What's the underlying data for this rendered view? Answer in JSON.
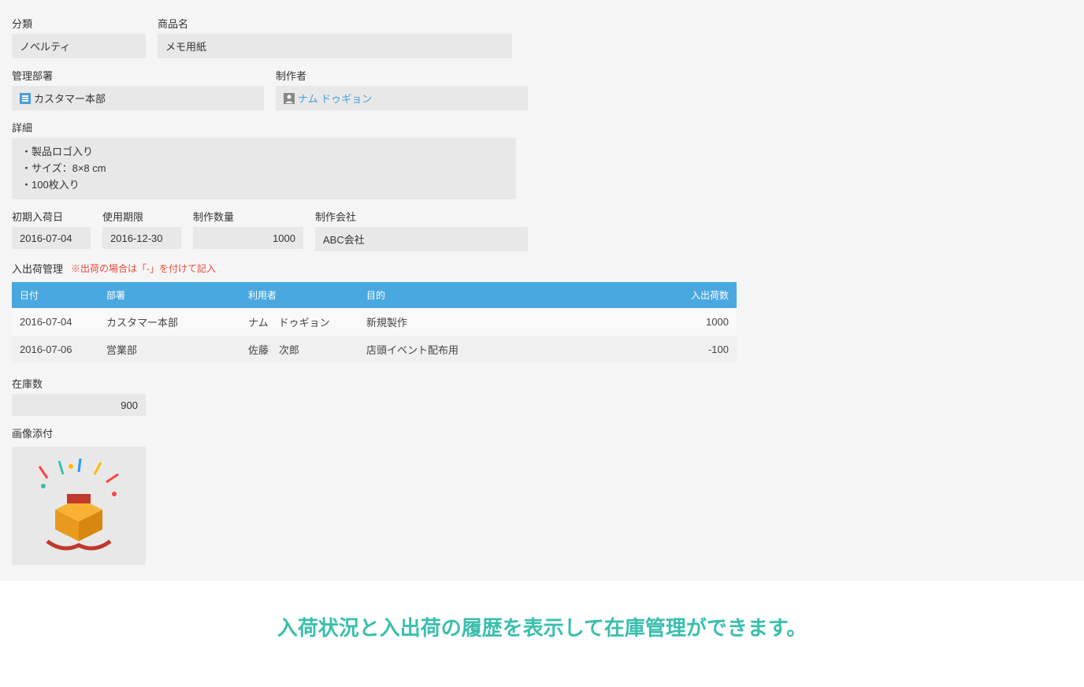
{
  "fields": {
    "category": {
      "label": "分類",
      "value": "ノベルティ"
    },
    "product": {
      "label": "商品名",
      "value": "メモ用紙"
    },
    "department": {
      "label": "管理部署",
      "value": "カスタマー本部"
    },
    "creator": {
      "label": "制作者",
      "value": "ナム ドゥギョン"
    },
    "details": {
      "label": "詳細",
      "lines": [
        "・製品ロゴ入り",
        "・サイズ：8×8 cm",
        "・100枚入り"
      ]
    },
    "initial_date": {
      "label": "初期入荷日",
      "value": "2016-07-04"
    },
    "expiration": {
      "label": "使用期限",
      "value": "2016-12-30"
    },
    "quantity": {
      "label": "制作数量",
      "value": "1000"
    },
    "company": {
      "label": "制作会社",
      "value": "ABC会社"
    },
    "stock": {
      "label": "在庫数",
      "value": "900"
    },
    "image": {
      "label": "画像添付"
    }
  },
  "management": {
    "label": "入出荷管理",
    "note": "※出荷の場合は「-」を付けて記入"
  },
  "table": {
    "headers": {
      "date": "日付",
      "dept": "部署",
      "user": "利用者",
      "purpose": "目的",
      "qty": "入出荷数"
    },
    "rows": [
      {
        "date": "2016-07-04",
        "dept": "カスタマー本部",
        "user": "ナム　ドゥギョン",
        "purpose": "新規製作",
        "qty": "1000"
      },
      {
        "date": "2016-07-06",
        "dept": "営業部",
        "user": "佐藤　次郎",
        "purpose": "店頭イベント配布用",
        "qty": "-100"
      }
    ]
  },
  "caption": "入荷状況と入出荷の履歴を表示して在庫管理ができます。"
}
